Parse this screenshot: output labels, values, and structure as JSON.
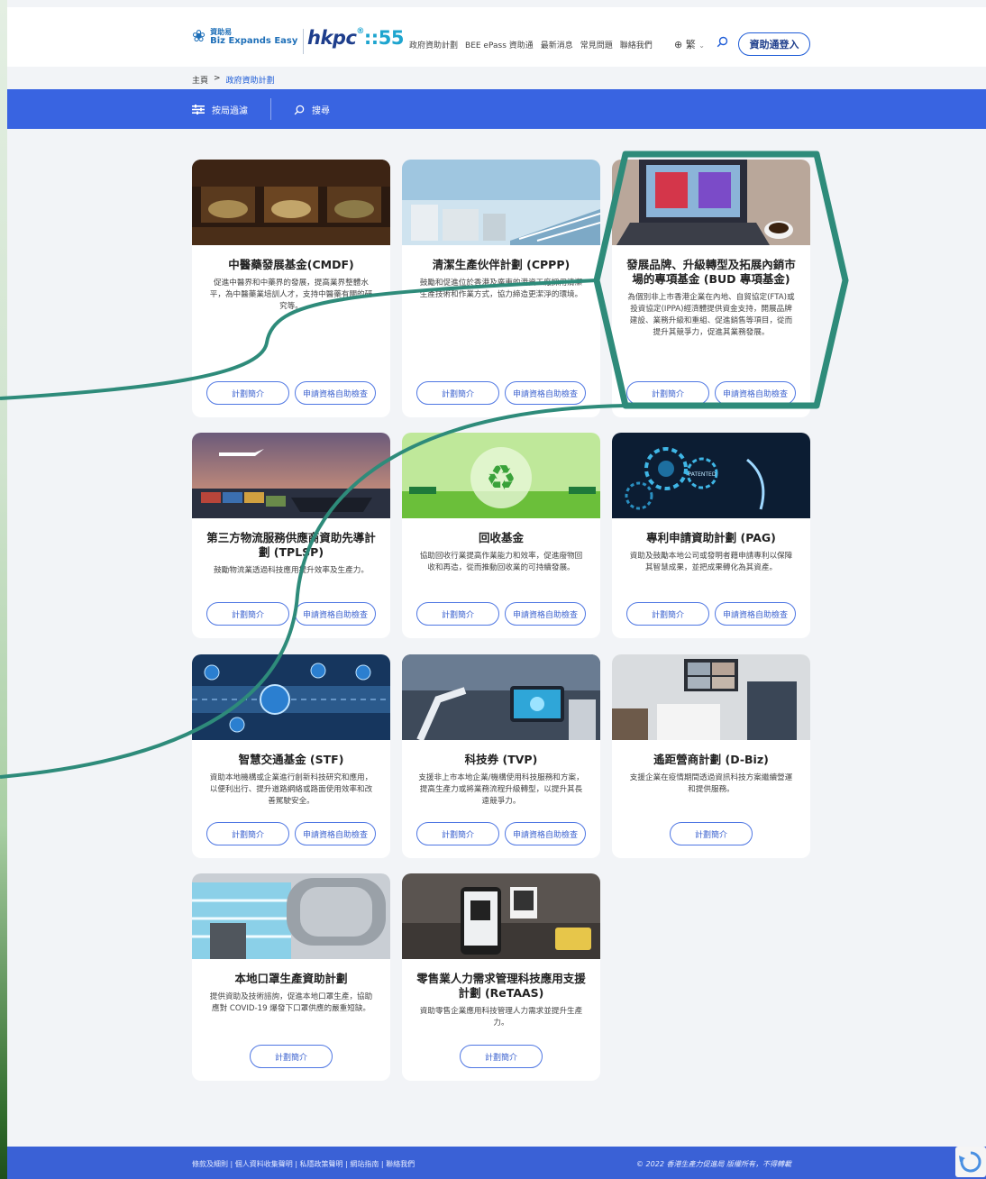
{
  "header": {
    "logo1_small": "資助易",
    "logo1_big": "Biz Expands Easy",
    "logo2_main": "hkpc",
    "logo2_sup": "®",
    "logo2_num": "::55",
    "nav": [
      "政府資助計劃",
      "BEE ePass 資助通",
      "最新消息",
      "常見問題",
      "聯絡我們"
    ],
    "lang": "繁",
    "login": "資助通登入"
  },
  "breadcrumb": {
    "home": "主頁",
    "sep": ">",
    "current": "政府資助計劃"
  },
  "filterbar": {
    "filter": "按局過濾",
    "search": "搜尋"
  },
  "buttons": {
    "intro": "計劃簡介",
    "check": "申請資格自助檢查"
  },
  "cards": [
    {
      "title": "中醫藥發展基金(CMDF)",
      "desc": "促進中醫界和中藥界的發展，提高業界整體水平，為中醫藥業培訓人才，支持中醫藥有關的研究等。"
    },
    {
      "title": "清潔生產伙伴計劃 (CPPP)",
      "desc": "鼓勵和促進位於香港及廣東的港資工廠採用清潔生產技術和作業方式，協力締造更潔淨的環境。"
    },
    {
      "title": "發展品牌、升級轉型及拓展內銷市場的專項基金 (BUD 專項基金)",
      "desc": "為個別非上市香港企業在內地、自貿協定(FTA)或投資協定(IPPA)經濟體提供資金支持，開展品牌建設、業務升級和重組、促進銷售等項目，從而提升其競爭力，促進其業務發展。"
    },
    {
      "title": "第三方物流服務供應商資助先導計劃 (TPLSP)",
      "desc": "鼓勵物流業透過科技應用提升效率及生產力。"
    },
    {
      "title": "回收基金",
      "desc": "協助回收行業提高作業能力和效率，促進廢物回收和再造，從而推動回收業的可持續發展。"
    },
    {
      "title": "專利申請資助計劃 (PAG)",
      "desc": "資助及鼓勵本地公司或發明者藉申請專利以保障其智慧成果，並把成果轉化為其資產。"
    },
    {
      "title": "智慧交通基金 (STF)",
      "desc": "資助本地機構或企業進行創新科技研究和應用，以便利出行、提升道路網絡或路面使用效率和改善駕駛安全。"
    },
    {
      "title": "科技券 (TVP)",
      "desc": "支援非上市本地企業/機構使用科技服務和方案，提高生產力或將業務流程升級轉型，以提升其長遠競爭力。"
    },
    {
      "title": "遙距營商計劃 (D-Biz)",
      "desc": "支援企業在疫情期間透過資訊科技方案繼續營運和提供服務。"
    },
    {
      "title": "本地口罩生產資助計劃",
      "desc": "提供資助及技術諮詢，促進本地口罩生產，協助應對 COVID-19 爆發下口罩供應的嚴重短缺。"
    },
    {
      "title": "零售業人力需求管理科技應用支援計劃 (ReTAAS)",
      "desc": "資助零售企業應用科技管理人力需求並提升生產力。"
    }
  ],
  "footer": {
    "links": "條款及細則 | 個人資料收集聲明 | 私隱政策聲明 | 網站指南 | 聯絡我們",
    "copyright": "© 2022 香港生產力促進局 版權所有，不得轉載"
  },
  "colors": {
    "brand_blue": "#3964e1",
    "highlight_green": "#2e8b7a",
    "page_bg": "#f2f4f7"
  }
}
